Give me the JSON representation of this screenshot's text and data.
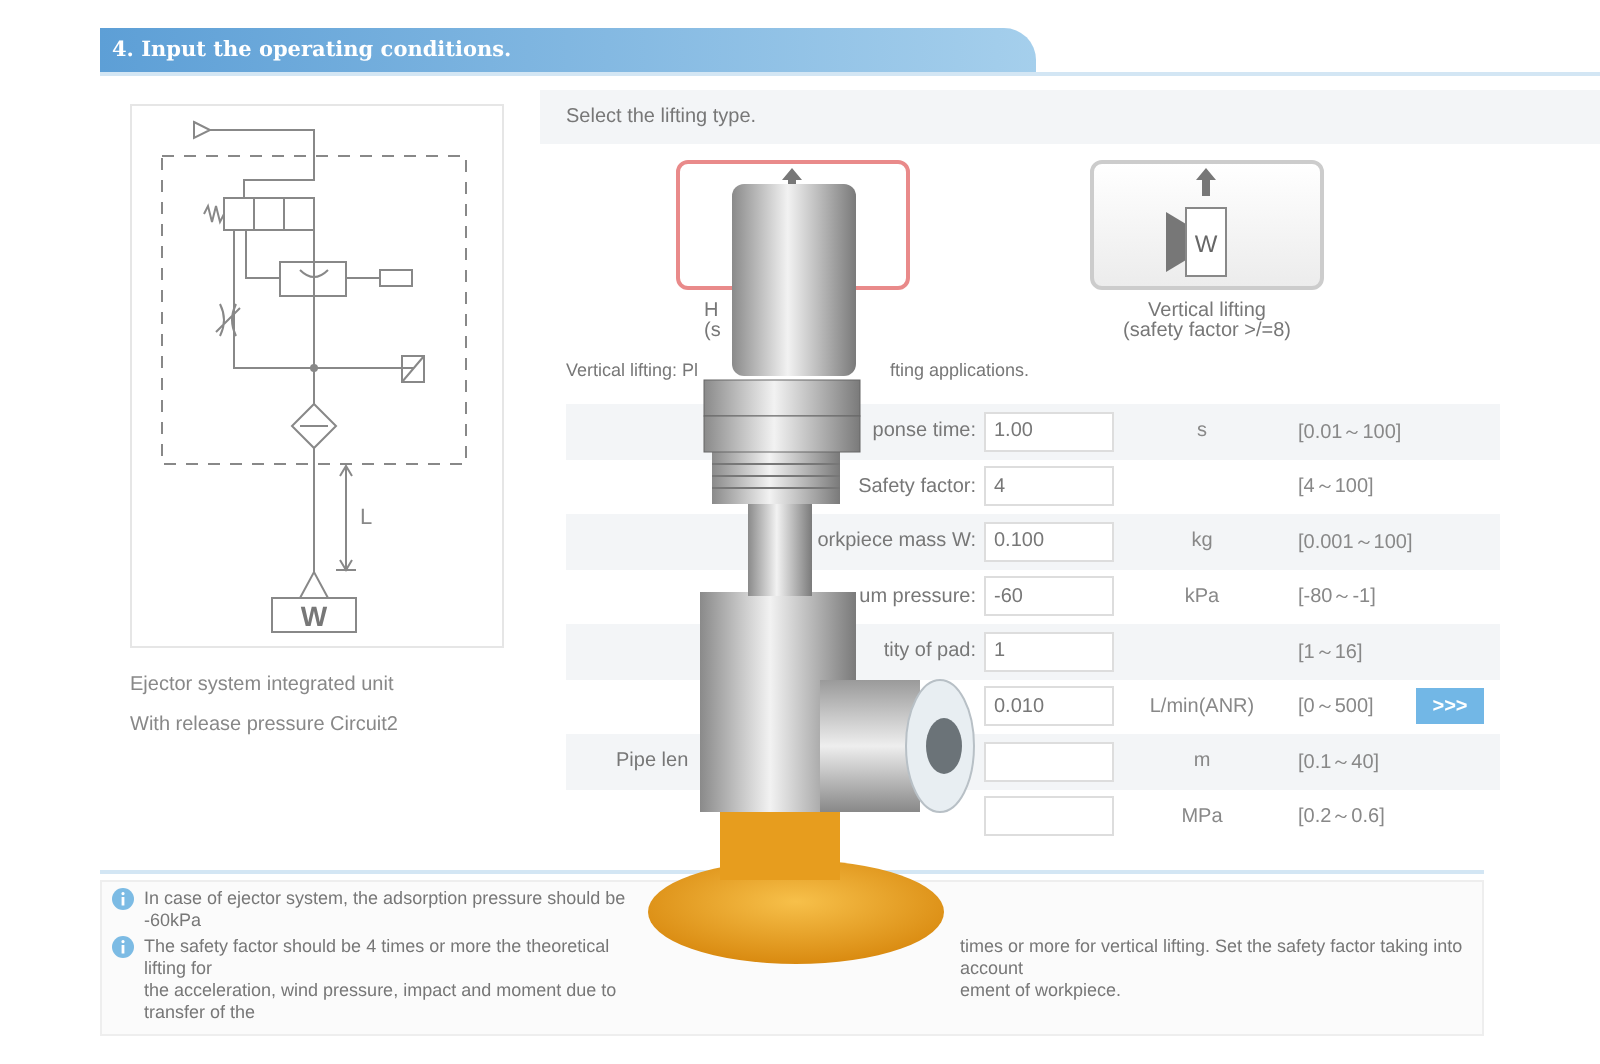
{
  "header": {
    "title": "4. Input the operating conditions."
  },
  "circuit": {
    "labels": {
      "length": "L",
      "workpiece": "W"
    },
    "captions": [
      "Ejector system integrated unit",
      "With release pressure Circuit2"
    ]
  },
  "lifting": {
    "prompt": "Select the lifting type.",
    "options": [
      {
        "kind": "horizontal",
        "lines": [
          "H",
          "(s"
        ],
        "selected": true
      },
      {
        "kind": "vertical",
        "lines": [
          "Vertical lifting",
          "(safety factor >/=8)"
        ],
        "icon_text": "W",
        "selected": false
      }
    ],
    "note_parts": [
      "Vertical lifting: Pl",
      "fting applications."
    ]
  },
  "conditions": [
    {
      "label": "ponse time:",
      "value": "1.00",
      "unit": "s",
      "range": "[0.01～100]"
    },
    {
      "label": "Safety factor:",
      "value": "4",
      "range": "[4～100]"
    },
    {
      "label": "orkpiece mass W:",
      "value": "0.100",
      "unit": "kg",
      "range": "[0.001～100]"
    },
    {
      "label": "um pressure:",
      "value": "-60",
      "unit": "kPa",
      "range": "[-80～-1]"
    },
    {
      "label": "tity of pad:",
      "value": "1",
      "range": "[1～16]"
    },
    {
      "value": "0.010",
      "unit": "L/min(ANR)",
      "range": "[0～500]",
      "button": ">>>"
    },
    {
      "label": "Pipe len",
      "unit": "m",
      "range": "[0.1～40]"
    },
    {
      "unit": "MPa",
      "range": "[0.2～0.6]"
    }
  ],
  "notes": [
    {
      "lines": [
        [
          "In case of ejector system, the adsorption pressure should be -60kPa"
        ]
      ]
    },
    {
      "lines": [
        [
          "The safety factor should be 4 times or more the theoretical lifting for",
          "times or more for vertical lifting. Set the safety factor taking into account"
        ],
        [
          "the acceleration, wind pressure, impact and moment due to transfer of the",
          "ement of workpiece."
        ]
      ]
    }
  ]
}
